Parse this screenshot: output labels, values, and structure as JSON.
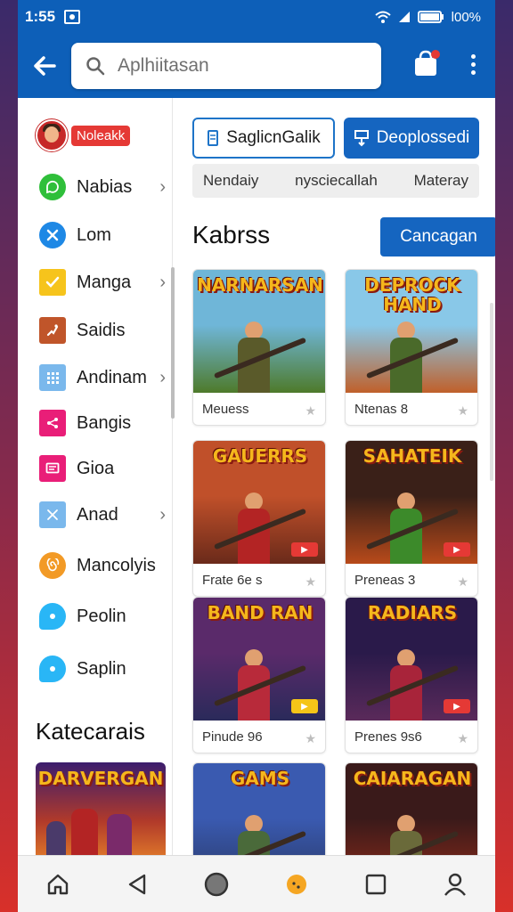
{
  "status_bar": {
    "time": "1:55",
    "battery": "l00%"
  },
  "header": {
    "search_placeholder": "Aplhiitasan"
  },
  "sidebar": {
    "profile_badge": "Noleakk",
    "items": [
      {
        "label": "Nabias",
        "icon": "chat-icon",
        "color": "#2fbf3a",
        "has_chevron": true
      },
      {
        "label": "Lom",
        "icon": "close-icon",
        "color": "#1e88e5",
        "has_chevron": false
      },
      {
        "label": "Manga",
        "icon": "check-icon",
        "color": "#f6c41c",
        "has_chevron": true
      },
      {
        "label": "Saidis",
        "icon": "run-icon",
        "color": "#c0552a",
        "has_chevron": false
      },
      {
        "label": "Andinam",
        "icon": "keypad-icon",
        "color": "#7ab8ec",
        "has_chevron": true
      },
      {
        "label": "Bangis",
        "icon": "share-icon",
        "color": "#e91e78",
        "has_chevron": false
      },
      {
        "label": "Gioa",
        "icon": "message-icon",
        "color": "#e91e78",
        "has_chevron": false
      },
      {
        "label": "Anad",
        "icon": "cross-icon",
        "color": "#7ab8ec",
        "has_chevron": true
      },
      {
        "label": "Mancolyis",
        "icon": "spiral-icon",
        "color": "#f29a26",
        "has_chevron": false
      },
      {
        "label": "Peolin",
        "icon": "bubble-icon",
        "color": "#29b6f6",
        "has_chevron": false
      },
      {
        "label": "Saplin",
        "icon": "bubble-icon",
        "color": "#29b6f6",
        "has_chevron": false
      }
    ],
    "categories_title": "Katecarais",
    "category_thumb_title": "DARVERGAN"
  },
  "main": {
    "btn_outline": "SaglicnGalik",
    "btn_solid": "Deoplossedi",
    "tabs": [
      "Nendaiy",
      "nysciecallah",
      "Materay"
    ],
    "section_title": "Kabrss",
    "section_button": "Cancagan",
    "cards": [
      {
        "art_title": "NARNARSAN",
        "label": "Meuess",
        "sky": "#6fb6d8",
        "ground": "#4e7a2a",
        "suit": "#5a5a2a"
      },
      {
        "art_title": "DEPROCK HAND",
        "label": "Ntenas 8",
        "sky": "#89c8e8",
        "ground": "#c0602a",
        "suit": "#4a6a2a"
      },
      {
        "art_title": "GAUERRS",
        "label": "Frate 6e s",
        "sky": "#c0502a",
        "ground": "#6a2a1a",
        "suit": "#b32424"
      },
      {
        "art_title": "SAHATEIK",
        "label": "Preneas 3",
        "sky": "#3a2018",
        "ground": "#b84a1a",
        "suit": "#3c8a2a"
      },
      {
        "art_title": "BAND RAN",
        "label": "Pinude 96",
        "sky": "#5a2a6a",
        "ground": "#2a2a5a",
        "suit": "#b82a3a"
      },
      {
        "art_title": "RADIARS",
        "label": "Prenes 9s6",
        "sky": "#2a1a4a",
        "ground": "#5a2a5a",
        "suit": "#a8243a"
      },
      {
        "art_title": "GAMS",
        "label": "",
        "sky": "#3a5ab0",
        "ground": "#2a3a6a",
        "suit": "#4a6a3a"
      },
      {
        "art_title": "CAIARAGAN",
        "label": "",
        "sky": "#3a1a1a",
        "ground": "#8a2a1a",
        "suit": "#6a6a3a"
      }
    ]
  }
}
